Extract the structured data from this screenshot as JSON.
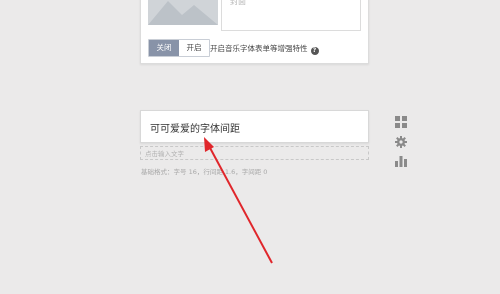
{
  "cover": {
    "placeholder_label": "封面"
  },
  "music_toggle": {
    "off_label": "关闭",
    "on_label": "开启",
    "selected": "off",
    "description": "开启音乐字体表单等增强特性",
    "help_icon": "question-circle-icon"
  },
  "title_block": {
    "text": "可可爱爱的字体间距"
  },
  "text_input": {
    "placeholder": "点击输入文字"
  },
  "base_style": {
    "text": "基础格式：字号 16，行间距 1.6，字间距 0"
  },
  "side_tools": [
    {
      "name": "grid-icon"
    },
    {
      "name": "gear-icon"
    },
    {
      "name": "bar-chart-icon"
    }
  ],
  "annotation": {
    "arrow_color": "#e0262b"
  },
  "colors": {
    "background": "#ebeaea",
    "toggle_off_bg": "#8893a8",
    "icon_gray": "#8a8a8a"
  }
}
